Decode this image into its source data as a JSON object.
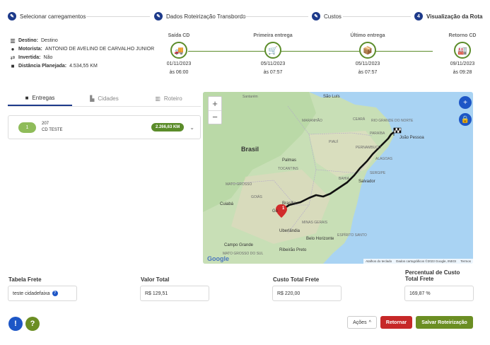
{
  "steps": [
    {
      "label": "Selecionar carregamentos",
      "icon": "pencil-icon"
    },
    {
      "label": "Dados Roteirização Transbordo",
      "icon": "pencil-icon"
    },
    {
      "label": "Custos",
      "icon": "pencil-icon"
    },
    {
      "label": "Visualização da Rota",
      "number": "4"
    }
  ],
  "summary": {
    "destino_label": "Destino:",
    "destino_value": "Destino",
    "motorista_label": "Motorista:",
    "motorista_value": "ANTONIO DE AVELINO DE CARVALHO JUNIOR",
    "invertida_label": "Invertida:",
    "invertida_value": "Não",
    "distancia_label": "Distância Planejada:",
    "distancia_value": "4.534,55 KM"
  },
  "timeline": [
    {
      "title": "Saída CD",
      "date": "01/11/2023",
      "time": "às 06:00",
      "icon": "truck-icon"
    },
    {
      "title": "Primeira entrega",
      "date": "05/11/2023",
      "time": "às 07:57",
      "icon": "delivery-person-icon"
    },
    {
      "title": "Último entrega",
      "date": "05/11/2023",
      "time": "às 07:57",
      "icon": "package-icon"
    },
    {
      "title": "Retorno CD",
      "date": "09/11/2023",
      "time": "às 09:28",
      "icon": "warehouse-icon"
    }
  ],
  "tabs": [
    {
      "label": "Entregas",
      "active": true
    },
    {
      "label": "Cidades",
      "active": false
    },
    {
      "label": "Roteiro",
      "active": false
    }
  ],
  "delivery": {
    "order": "1",
    "code": "207",
    "name": "CD TESTE",
    "distance": "2.266,63 KM"
  },
  "map": {
    "zoom_in": "+",
    "zoom_out": "−",
    "labels": {
      "santarem": "Santarém",
      "sao_luis": "São Luís",
      "brasil": "Brasil",
      "maranhao": "MARANHÃO",
      "ceara": "CEARÁ",
      "rio_grande_norte": "RIO GRANDE DO NORTE",
      "paraiba": "PARAÍBA",
      "joao_pessoa": "João Pessoa",
      "pernambuco": "PERNAMBUCO",
      "piaui": "PIAUÍ",
      "alagoas": "ALAGOAS",
      "sergipe": "SERGIPE",
      "palmas": "Palmas",
      "tocantins": "TOCANTINS",
      "bahia": "BAHIA",
      "salvador": "Salvador",
      "mato_grosso": "MATO GROSSO",
      "cuiaba": "Cuiabá",
      "brasilia": "Brasília",
      "goiania": "Go",
      "minas_gerais": "MINAS GERAIS",
      "uberlandia": "Uberlândia",
      "belo_horizonte": "Belo Horizonte",
      "campo_grande": "Campo Grande",
      "mato_grosso_sul": "MATO GROSSO DO SUL",
      "ribeirao": "Ribeirão Preto",
      "goias": "GOIÁS",
      "espirito_santo": "ESPÍRITO SANTO"
    },
    "marker": "1",
    "attribution": [
      "Atalhos do teclado",
      "Dados cartográficos ©2023 Google, INEGI",
      "Termos"
    ],
    "google": "Google"
  },
  "fields": {
    "tabela_label": "Tabela Frete",
    "tabela_value": "teste cidadefaixa",
    "valor_label": "Valor Total",
    "valor_value": "R$ 129,51",
    "custo_label": "Custo Total Frete",
    "custo_value": "R$ 220,00",
    "percentual_label_1": "Percentual de Custo",
    "percentual_label_2": "Total Frete",
    "percentual_value": "169,87 %"
  },
  "footer": {
    "info": "!",
    "help": "?",
    "acoes": "Ações",
    "retornar": "Retornar",
    "salvar": "Salvar Roteirização"
  },
  "colors": {
    "primary": "#1d3a8a",
    "green": "#5b8c2a",
    "red": "#c62828",
    "save": "#6b8e23"
  }
}
